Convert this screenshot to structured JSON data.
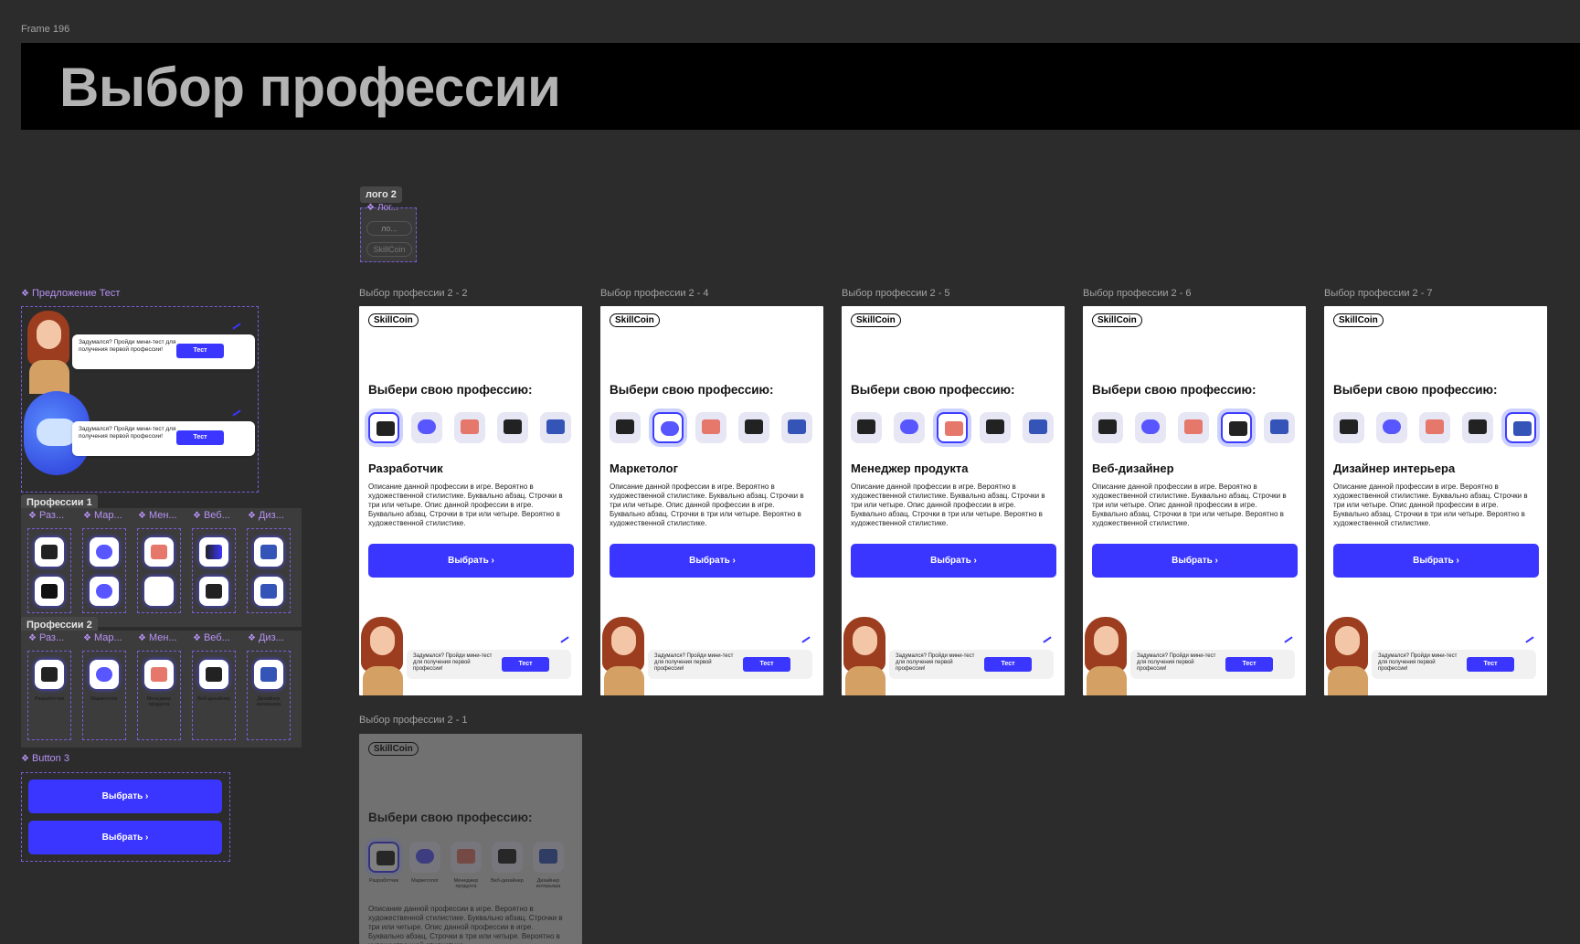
{
  "frame_label": "Frame 196",
  "header_title": "Выбор профессии",
  "logo_tag": "лого 2",
  "logo_items": [
    "Лог...",
    "ло...",
    "SkillCoin"
  ],
  "offer_label": "Предложение Тест",
  "offer_bubble": {
    "text": "Задумался? Пройди мини-тест для получения первой профессии!",
    "button": "Тест"
  },
  "professions1_tag": "Профессии 1",
  "professions2_tag": "Профессии 2",
  "variant_labels": [
    "Раз...",
    "Мар...",
    "Мен...",
    "Веб...",
    "Диз..."
  ],
  "profession_names": [
    "Разработчик",
    "Маркетолог",
    "Менеджер продукта",
    "Веб-дизайнер",
    "Дизайнер интерьера"
  ],
  "button3_label": "Button 3",
  "choose_button": "Выбрать",
  "brand": "SkillCoin",
  "choose_heading": "Выбери свою профессию:",
  "description": "Описание данной профессии в игре. Вероятно в художественной стилистике. Буквально абзац. Строчки в три или четыре. Опис данной профессии в игре. Буквально абзац. Строчки в три или четыре. Вероятно в художественной стилистике.",
  "teaser": {
    "text": "Задумался? Пройди мини-тест для получения первой профессии!",
    "button": "Тест"
  },
  "frames": [
    {
      "label": "Выбор профессии 2 - 2",
      "profession": "Разработчик",
      "selected": 0
    },
    {
      "label": "Выбор профессии 2 - 4",
      "profession": "Маркетолог",
      "selected": 1
    },
    {
      "label": "Выбор профессии 2 - 5",
      "profession": "Менеджер продукта",
      "selected": 2
    },
    {
      "label": "Выбор профессии 2 - 6",
      "profession": "Веб-дизайнер",
      "selected": 3
    },
    {
      "label": "Выбор профессии 2 - 7",
      "profession": "Дизайнер интерьера",
      "selected": 4
    }
  ],
  "faded_frame": {
    "label": "Выбор профессии 2 - 1",
    "captions": [
      "Разработчик",
      "Маркетолог",
      "Менеджер продукта",
      "Веб-дизайнер",
      "Дизайнер интерьера"
    ]
  },
  "icon_names": [
    "laptop-icon",
    "megaphone-icon",
    "basket-icon",
    "credit-card-icon",
    "chair-icon"
  ],
  "colors": {
    "accent": "#3a36ff",
    "canvas": "#2c2c2c",
    "component": "#b792f5"
  }
}
